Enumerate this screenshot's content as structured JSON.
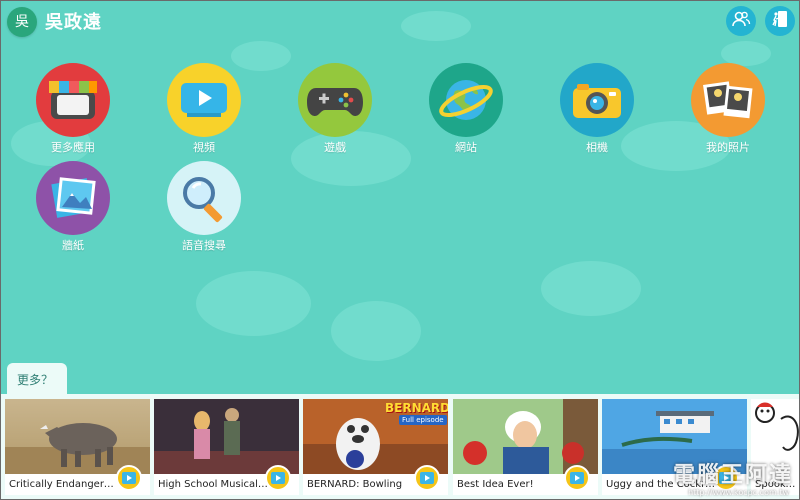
{
  "header": {
    "avatar_char": "吳",
    "username": "吳政遠"
  },
  "apps": [
    {
      "label": "更多應用",
      "icon": "store-icon"
    },
    {
      "label": "視頻",
      "icon": "video-icon"
    },
    {
      "label": "遊戲",
      "icon": "gamepad-icon"
    },
    {
      "label": "網站",
      "icon": "globe-icon"
    },
    {
      "label": "相機",
      "icon": "camera-icon"
    },
    {
      "label": "我的照片",
      "icon": "photos-icon"
    },
    {
      "label": "牆紙",
      "icon": "wallpaper-icon"
    },
    {
      "label": "語音搜尋",
      "icon": "voice-search-icon"
    }
  ],
  "more": {
    "label": "更多？",
    "videos": [
      {
        "title": "Critically Endangere..."
      },
      {
        "title": "High School Musical ..."
      },
      {
        "title": "BERNARD: Bowling",
        "banner": "BERNARD",
        "sub": "Full episode"
      },
      {
        "title": "Best Idea Ever!"
      },
      {
        "title": "Uggy and the Cockro..."
      },
      {
        "title": "Spooked!"
      }
    ]
  },
  "watermark": {
    "text": "電腦王阿達",
    "url": "http://www.kocpc.com.tw"
  },
  "colors": {
    "background": "#5fd3c3",
    "strip": "#ecfbf8",
    "play": "#f5c518",
    "header_button": "#24b4d2"
  }
}
